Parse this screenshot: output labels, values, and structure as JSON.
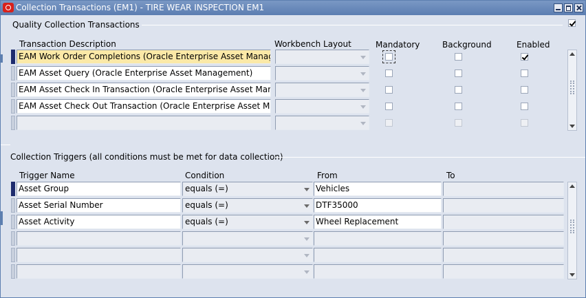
{
  "window": {
    "title": "Collection Transactions (EM1) - TIRE WEAR INSPECTION EM1"
  },
  "transactions": {
    "section_title": "Quality Collection Transactions",
    "headers": {
      "description": "Transaction Description",
      "workbench": "Workbench Layout",
      "mandatory": "Mandatory",
      "background": "Background",
      "enabled": "Enabled"
    },
    "rows": [
      {
        "description": "EAM Work Order Completions (Oracle Enterprise Asset Manag",
        "workbench": "",
        "mandatory": false,
        "background": false,
        "enabled": true
      },
      {
        "description": "EAM Asset Query (Oracle Enterprise Asset Management)",
        "workbench": "",
        "mandatory": false,
        "background": false,
        "enabled": false
      },
      {
        "description": "EAM Asset Check In Transaction (Oracle Enterprise Asset Mar",
        "workbench": "",
        "mandatory": false,
        "background": false,
        "enabled": false
      },
      {
        "description": "EAM Asset Check Out Transaction (Oracle Enterprise Asset M",
        "workbench": "",
        "mandatory": false,
        "background": false,
        "enabled": false
      },
      {
        "description": "",
        "workbench": "",
        "mandatory": false,
        "background": false,
        "enabled": false
      }
    ]
  },
  "triggers": {
    "section_title": "Collection Triggers (all conditions must be met for data collection)",
    "headers": {
      "name": "Trigger Name",
      "condition": "Condition",
      "from": "From",
      "to": "To"
    },
    "rows": [
      {
        "name": "Asset Group",
        "condition": "equals (=)",
        "from": "Vehicles",
        "to": ""
      },
      {
        "name": "Asset Serial Number",
        "condition": "equals (=)",
        "from": "DTF35000",
        "to": ""
      },
      {
        "name": "Asset Activity",
        "condition": "equals (=)",
        "from": "Wheel Replacement",
        "to": ""
      },
      {
        "name": "",
        "condition": "",
        "from": "",
        "to": ""
      },
      {
        "name": "",
        "condition": "",
        "from": "",
        "to": ""
      },
      {
        "name": "",
        "condition": "",
        "from": "",
        "to": ""
      }
    ]
  },
  "colors": {
    "titlebar": "#5b7db1",
    "active_row": "#fbe9a7",
    "panel": "#dde3ee"
  }
}
